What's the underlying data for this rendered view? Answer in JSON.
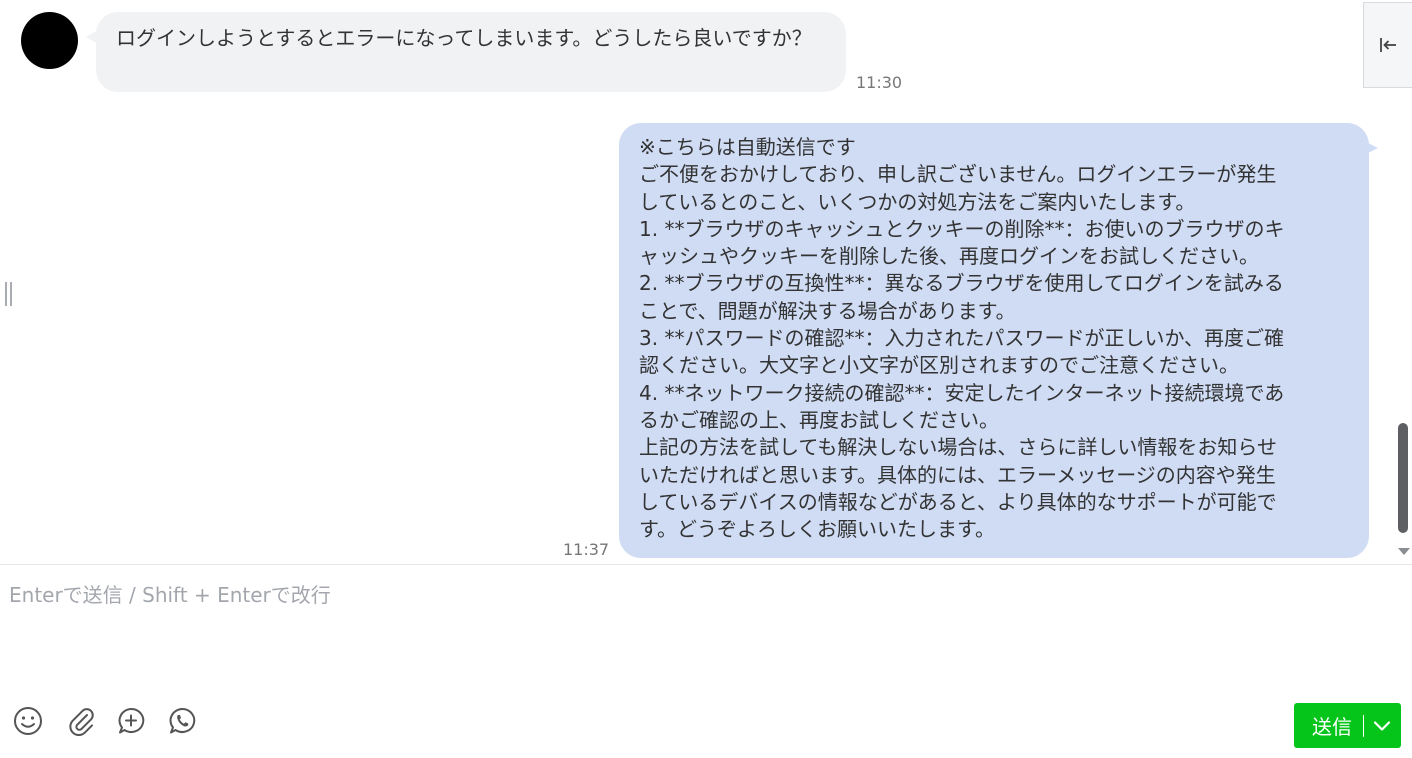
{
  "chat": {
    "incoming": {
      "text": "ログインしようとするとエラーになってしまいます。どうしたら良いですか？",
      "time": "11:30"
    },
    "outgoing": {
      "lines": [
        "※こちらは自動送信です",
        "ご不便をおかけしており、申し訳ございません。ログインエラーが発生",
        "しているとのこと、いくつかの対処方法をご案内いたします。",
        "1. **ブラウザのキャッシュとクッキーの削除**：お使いのブラウザのキ",
        "ャッシュやクッキーを削除した後、再度ログインをお試しください。",
        "2. **ブラウザの互換性**：異なるブラウザを使用してログインを試みる",
        "ことで、問題が解決する場合があります。",
        "3. **パスワードの確認**：入力されたパスワードが正しいか、再度ご確",
        "認ください。大文字と小文字が区別されますのでご注意ください。",
        "4. **ネットワーク接続の確認**：安定したインターネット接続環境であ",
        "るかご確認の上、再度お試しください。",
        "上記の方法を試しても解決しない場合は、さらに詳しい情報をお知らせ",
        "いただければと思います。具体的には、エラーメッセージの内容や発生",
        "しているデバイスの情報などがあると、より具体的なサポートが可能で",
        "す。どうぞよろしくお願いいたします。"
      ],
      "time": "11:37"
    }
  },
  "composer": {
    "placeholder": "Enterで送信 / Shift + Enterで改行",
    "value": "",
    "send_label": "送信"
  },
  "icons": {
    "collapse": "collapse-panel-icon",
    "emoji": "emoji-icon",
    "attach": "paperclip-icon",
    "add_message": "add-message-icon",
    "call": "phone-call-icon",
    "send_options": "chevron-down-icon"
  },
  "colors": {
    "incoming_bubble": "#f1f2f4",
    "outgoing_bubble": "#cfdcf4",
    "send_button": "#06c51a",
    "text": "#333333",
    "placeholder": "#a3a7ad"
  }
}
